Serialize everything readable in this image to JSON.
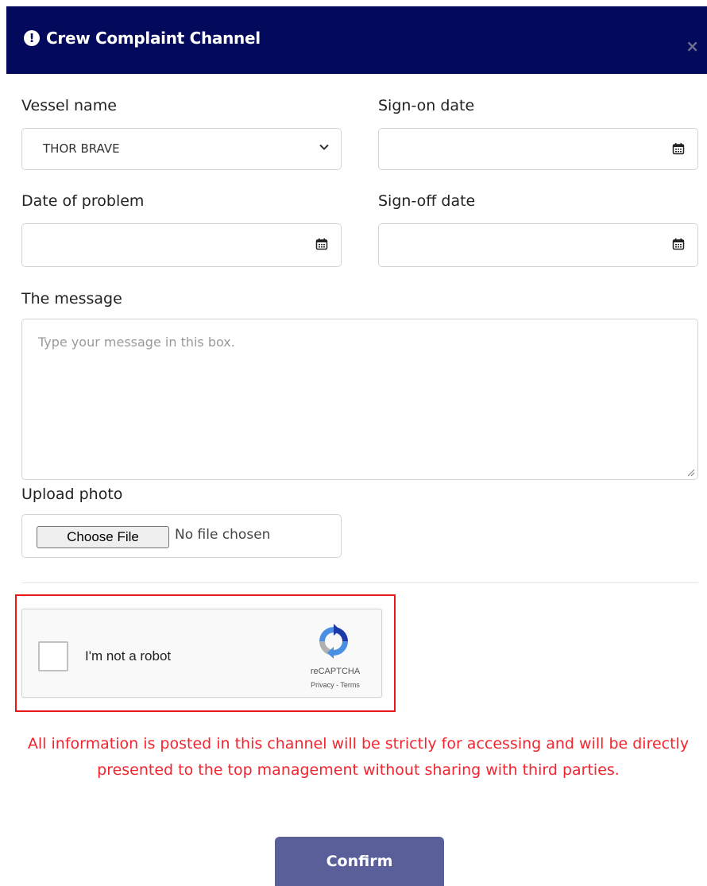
{
  "header": {
    "title": "Crew Complaint Channel",
    "close_label": "×",
    "icon": "exclamation-circle-icon",
    "color": "#030a5c"
  },
  "form": {
    "vessel_name_label": "Vessel name",
    "vessel_name_value": "THOR BRAVE",
    "sign_on_label": "Sign-on date",
    "date_of_problem_label": "Date of problem",
    "sign_off_label": "Sign-off date",
    "message_label": "The message",
    "message_placeholder": "Type your message in this box.",
    "upload_label": "Upload photo",
    "choose_file_label": "Choose File",
    "file_status": "No file chosen"
  },
  "captcha": {
    "checkbox_label": "I'm not a robot",
    "brand": "reCAPTCHA",
    "links": "Privacy - Terms"
  },
  "notice": "All information is posted in this channel will be strictly for accessing and will be directly presented to the top management without sharing with third parties.",
  "confirm_label": "Confirm",
  "colors": {
    "header": "#030a5c",
    "notice": "#f0252f",
    "confirm": "#5a5f9a",
    "highlight_border": "#e81818"
  }
}
